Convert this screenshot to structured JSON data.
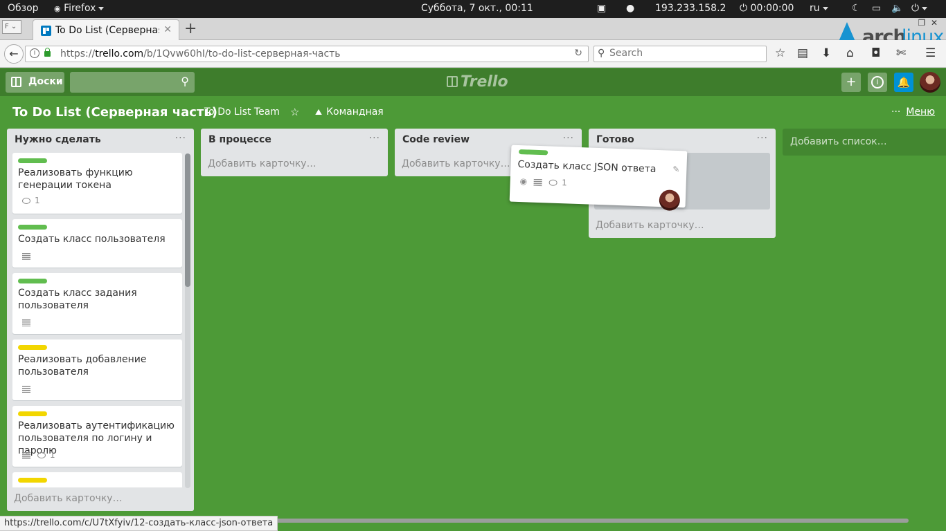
{
  "system_bar": {
    "overview": "Обзор",
    "app": "Firefox",
    "clock": "Суббота,  7 окт., 00:11",
    "ip": "193.233.158.2",
    "timer": "00:00:00",
    "lang": "ru"
  },
  "browser": {
    "tab_title": "To Do List (Серверная часть)",
    "url_prefix": "https://",
    "url_domain": "trello.com",
    "url_path": "/b/1Qvw60hI/to-do-list-серверная-часть",
    "search_placeholder": "Search",
    "status_url": "https://trello.com/c/U7tXfyiv/12-создать-класс-json-ответа"
  },
  "trello": {
    "boards_label": "Доски",
    "logo": "Trello",
    "board_title": "To Do List (Серверная часть)",
    "team": "To Do List Team",
    "visibility": "Командная",
    "menu": "Меню",
    "add_list": "Добавить список…",
    "add_card": "Добавить карточку…",
    "lists": [
      {
        "title": "Нужно сделать",
        "cards": [
          {
            "title": "Реализовать функцию генерации токена",
            "label_color": "#61bd4f",
            "comments": "1"
          },
          {
            "title": "Создать класс пользователя",
            "label_color": "#61bd4f"
          },
          {
            "title": "Создать класс задания пользователя",
            "label_color": "#61bd4f"
          },
          {
            "title": "Реализовать добавление пользователя",
            "label_color": "#f2d600"
          },
          {
            "title": "Реализовать аутентификацию пользователя по логину и паролю",
            "label_color": "#f2d600",
            "comments": "1"
          },
          {
            "title": "",
            "label_color": "#f2d600"
          }
        ]
      },
      {
        "title": "В процессе",
        "cards": []
      },
      {
        "title": "Code review",
        "cards": []
      },
      {
        "title": "Готово",
        "cards": []
      }
    ],
    "dragged_card": {
      "title": "Создать класс JSON ответа",
      "label_color": "#61bd4f",
      "comments": "1"
    }
  },
  "colors": {
    "board_bg": "#4d9a37",
    "header_bg": "#3e7d2c",
    "notify_btn": "#0091d6"
  }
}
